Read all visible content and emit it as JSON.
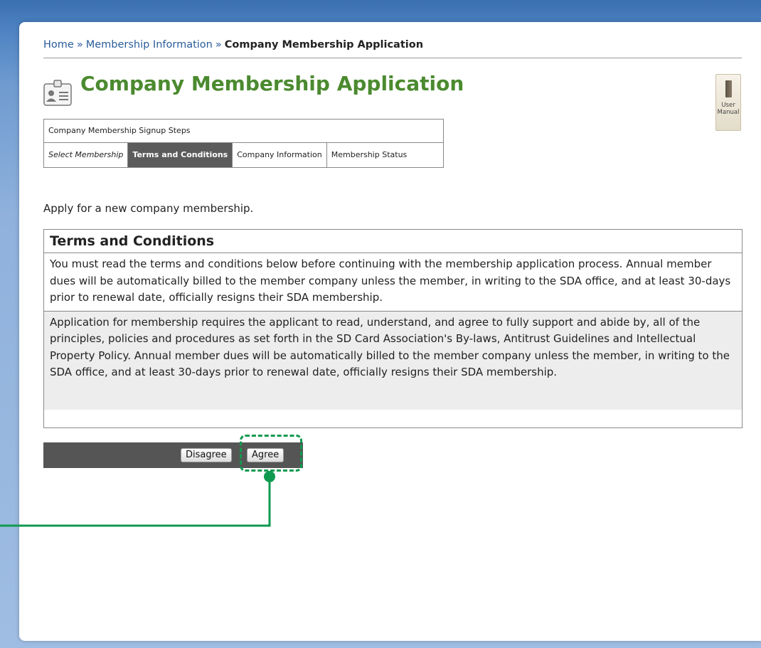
{
  "breadcrumb": {
    "home": "Home",
    "separator": "»",
    "membership_info": "Membership Information",
    "current": "Company Membership Application"
  },
  "page": {
    "title": "Company Membership Application",
    "title_color": "#4b8a2f",
    "title_icon": "id-card-icon"
  },
  "user_manual": {
    "line1": "User",
    "line2": "Manual",
    "icon": "book-icon"
  },
  "steps": {
    "caption": "Company Membership Signup Steps",
    "items": [
      {
        "label": "Select Membership",
        "state": "done"
      },
      {
        "label": "Terms and Conditions",
        "state": "active"
      },
      {
        "label": "Company Information",
        "state": "pending"
      },
      {
        "label": "Membership Status",
        "state": "pending"
      }
    ]
  },
  "intro_text": "Apply for a new company membership.",
  "terms": {
    "heading": "Terms and Conditions",
    "notice": "You must read the terms and conditions below before continuing with the membership application process. Annual member dues will be automatically billed to the member company unless the member, in writing to the SDA office, and at least 30-days prior to renewal date, officially resigns their SDA membership.",
    "body": "Application for membership requires the applicant to read, understand, and agree to fully support and abide by, all of the principles, policies and procedures as set forth in the SD Card Association's By-laws, Antitrust Guidelines and Intellectual Property Policy. Annual member dues will be automatically billed to the member company unless the member, in writing to the SDA office, and at least 30-days prior to renewal date, officially resigns their SDA membership."
  },
  "actions": {
    "disagree_label": "Disagree",
    "agree_label": "Agree"
  },
  "colors": {
    "highlight": "#109a4f",
    "active_step": "#5b5b5b",
    "link": "#2a5d9b"
  }
}
